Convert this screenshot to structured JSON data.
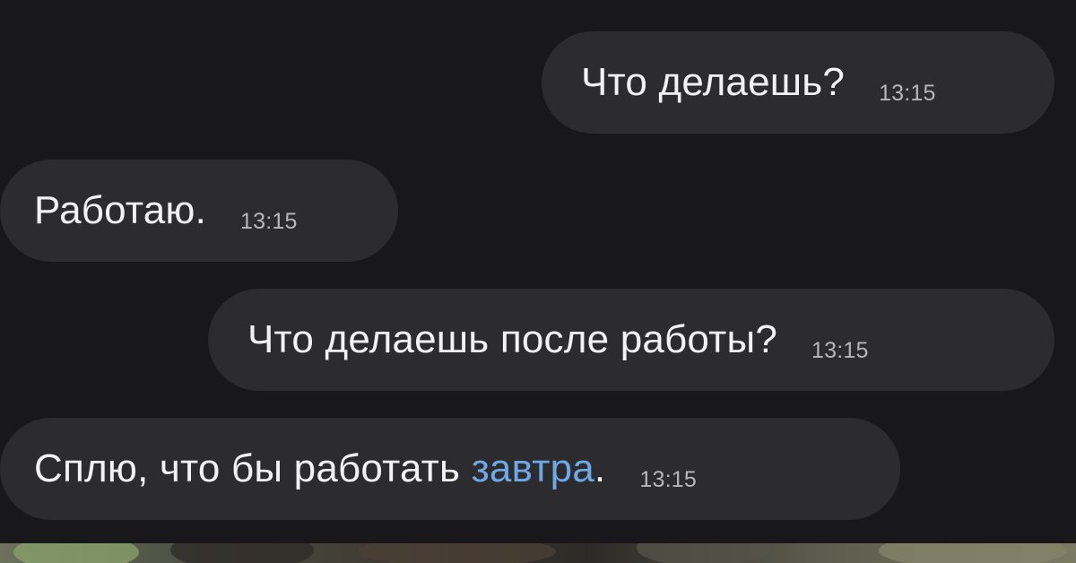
{
  "messages": [
    {
      "id": "msg1",
      "side": "outgoing",
      "text": "Что делаешь?",
      "time": "13:15"
    },
    {
      "id": "msg2",
      "side": "incoming",
      "text": "Работаю.",
      "time": "13:15"
    },
    {
      "id": "msg3",
      "side": "outgoing",
      "text": "Что делаешь после работы?",
      "time": "13:15"
    },
    {
      "id": "msg4",
      "side": "incoming",
      "text_before": "Сплю, что бы работать ",
      "link": "завтра",
      "text_after": ".",
      "time": "13:15"
    }
  ],
  "theme": {
    "background": "#18181a",
    "bubble": "#2c2c2e",
    "text": "#f2f2f2",
    "time": "#b7b7bb",
    "link": "#6ea8e6"
  }
}
